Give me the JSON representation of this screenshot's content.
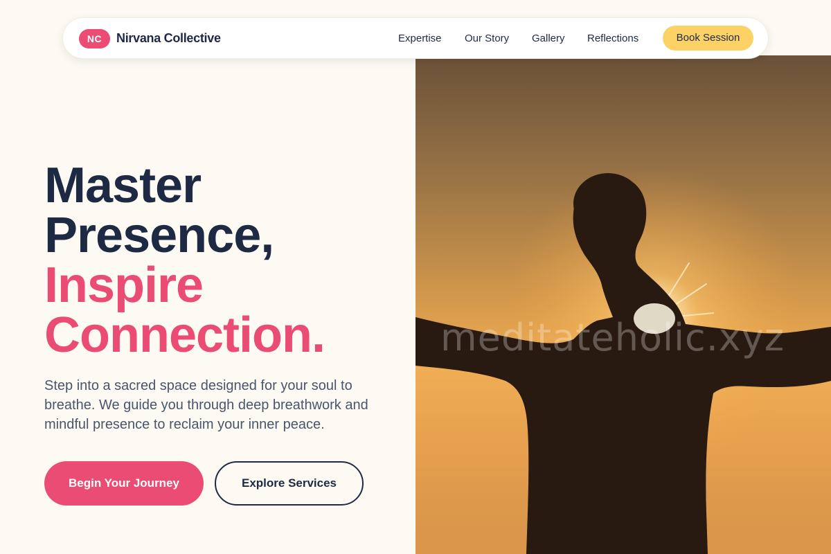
{
  "nav": {
    "logo_badge": "NC",
    "brand_name": "Nirvana Collective",
    "links": [
      "Expertise",
      "Our Story",
      "Gallery",
      "Reflections"
    ],
    "cta": "Book Session"
  },
  "hero": {
    "headline_lines": [
      "Master",
      "Presence,",
      "Inspire",
      "Connection."
    ],
    "description": "Step into a sacred space designed for your soul to breathe. We guide you through deep breathwork and mindful presence to reclaim your inner peace.",
    "primary_button": "Begin Your Journey",
    "secondary_button": "Explore Services",
    "image_watermark": "meditateholic.xyz"
  },
  "colors": {
    "background": "#fcfaf3",
    "accent_pink": "#ea4c73",
    "accent_yellow": "#fcd267",
    "text_dark": "#1e2a44"
  }
}
